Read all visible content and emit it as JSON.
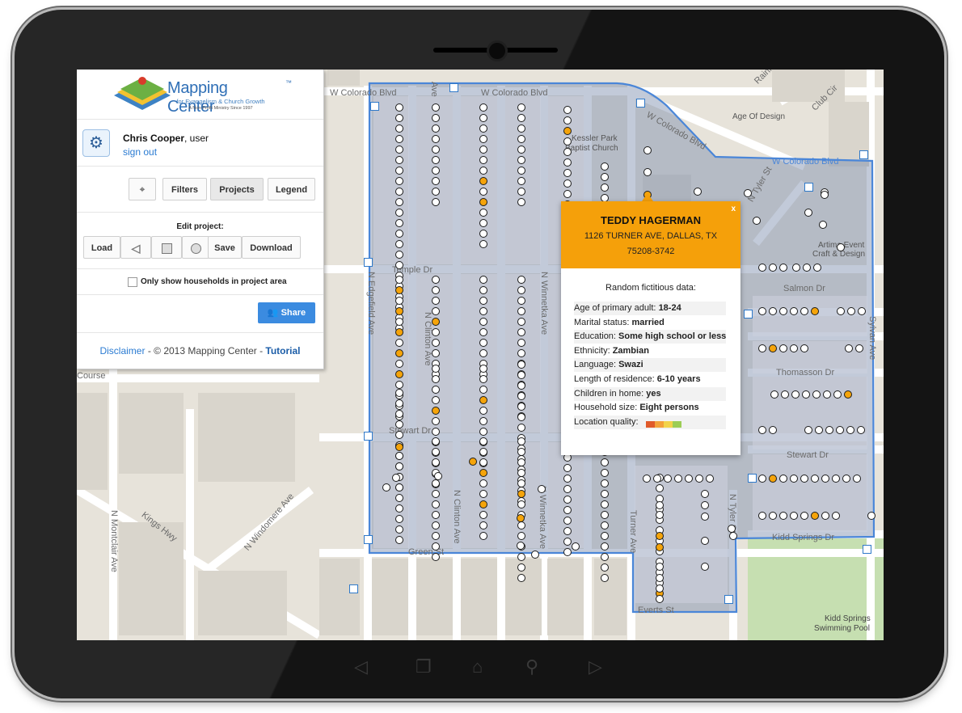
{
  "app": {
    "logo_title": "Mapping Center",
    "logo_tm": "™",
    "logo_subtitle": "for Evangelism & Church Growth",
    "logo_tagline": "A Non-Profit Ministry Since 1997"
  },
  "user": {
    "name": "Chris Cooper",
    "role": ", user",
    "signout": "sign out"
  },
  "toolbar": {
    "filters": "Filters",
    "projects": "Projects",
    "legend": "Legend"
  },
  "edit": {
    "label": "Edit project:",
    "load": "Load",
    "save": "Save",
    "download": "Download"
  },
  "checkbox": {
    "label": "Only show households in project area",
    "checked": false
  },
  "share": {
    "label": "Share"
  },
  "footer": {
    "disclaimer": "Disclaimer",
    "copyright": " - © 2013 Mapping Center - ",
    "tutorial": "Tutorial"
  },
  "map": {
    "streets": {
      "w_colorado_1": "W Colorado Blvd",
      "w_colorado_2": "W Colorado Blvd",
      "w_colorado_3": "W Colorado Blvd",
      "w_colorado_diag": "W Colorado Blvd",
      "temple": "Temple Dr",
      "stewart": "Stewart Dr",
      "stewart2": "Stewart Dr",
      "green": "Green St",
      "evers": "Everts St",
      "salmon": "Salmon Dr",
      "thomasson": "Thomasson Dr",
      "kidd": "Kidd Springs Dr",
      "clinton": "N Clinton Ave",
      "clinton2": "N Clinton Ave",
      "winnetka": "N Winnetka Ave",
      "winnetka2": "N Winnetka Ave",
      "edgefield": "N Edgefield Ave",
      "windomere": "N Windomere Ave",
      "montclair": "N Montclair Ave",
      "kings": "Kings Hwy",
      "turner": "Turner Ave",
      "tyler": "N Tyler St",
      "tyler2": "N Tyler St",
      "sylvan": "Sylvan Ave",
      "course": "Course",
      "rainier": "Rainier",
      "club": "Club Cir",
      "ave": "Ave"
    },
    "pois": {
      "age_of_design": "Age Of Design",
      "kessler_1": "Kessler Park",
      "kessler_2": "Baptist Church",
      "artima_1": "Artima Event",
      "artima_2": "Craft & Design",
      "kidd_pool_1": "Kidd Springs",
      "kidd_pool_2": "Swimming Pool"
    }
  },
  "popup": {
    "close": "x",
    "name": "TEDDY HAGERMAN",
    "address": "1126 TURNER AVE, DALLAS, TX",
    "zip": "75208-3742",
    "intro": "Random fictitious data:",
    "rows": [
      {
        "label": "Age of primary adult: ",
        "value": "18-24"
      },
      {
        "label": "Marital status: ",
        "value": "married"
      },
      {
        "label": "Education: ",
        "value": "Some high school or less"
      },
      {
        "label": "Ethnicity: ",
        "value": "Zambian"
      },
      {
        "label": "Language: ",
        "value": "Swazi"
      },
      {
        "label": "Length of residence: ",
        "value": "6-10 years"
      },
      {
        "label": "Children in home: ",
        "value": "yes"
      },
      {
        "label": "Household size: ",
        "value": "Eight persons"
      },
      {
        "label": "Location quality: ",
        "value": ""
      }
    ],
    "quality_colors": [
      "#e05a2a",
      "#f3a13a",
      "#f2d34a",
      "#9ccd55"
    ]
  },
  "colors": {
    "accent": "#3b8be0",
    "popup_header": "#f5a00a",
    "household_highlight": "#f5a40a",
    "project_outline": "#4a86d8"
  }
}
